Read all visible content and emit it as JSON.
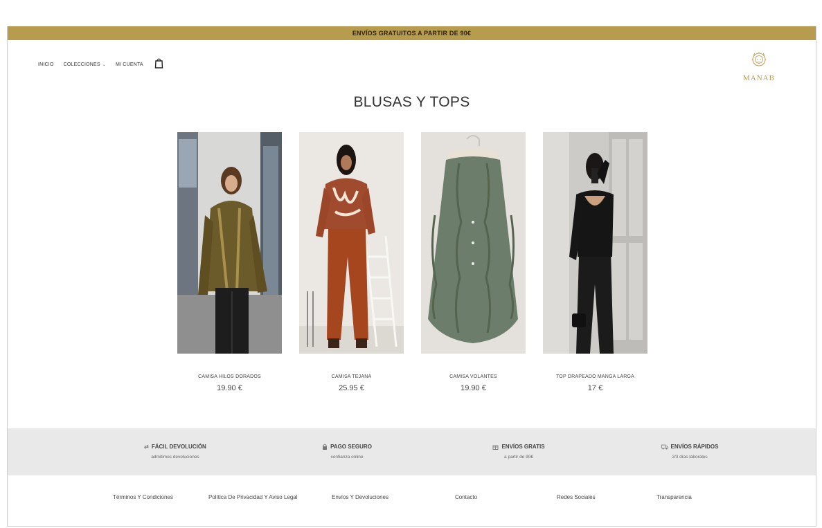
{
  "announcement": "ENVÍOS GRATUITOS A PARTIR DE 90€",
  "nav": {
    "home": "INICIO",
    "collections": "COLECCIONES",
    "collections_caret": "⌄",
    "account": "MI CUENTA"
  },
  "logo": {
    "text": "MANAB",
    "icon": "lion-icon",
    "color": "#b89c4d"
  },
  "page": {
    "title": "BLUSAS Y TOPS"
  },
  "products": [
    {
      "name": "CAMISA HILOS DORADOS",
      "price": "19.90 €"
    },
    {
      "name": "CAMISA TEJANA",
      "price": "25.95 €"
    },
    {
      "name": "CAMISA VOLANTES",
      "price": "19.90 €"
    },
    {
      "name": "TOP DRAPEADO MANGA LARGA",
      "price": "17 €"
    }
  ],
  "features": [
    {
      "title": "FÁCIL DEVOLUCIÓN",
      "sub": "admitimos devoluciones",
      "icon": "return-arrows-icon"
    },
    {
      "title": "PAGO SEGURO",
      "sub": "confianza online",
      "icon": "lock-icon"
    },
    {
      "title": "ENVÍOS GRATIS",
      "sub": "a partir de 90€",
      "icon": "gift-icon"
    },
    {
      "title": "ENVÍOS RÁPIDOS",
      "sub": "2/3 días laborales",
      "icon": "truck-icon"
    }
  ],
  "footer": {
    "links": [
      "Términos Y Condiciones",
      "Política De Privacidad Y Aviso Legal",
      "Envíos Y Devoluciones",
      "Contacto",
      "Redes Sociales",
      "Transparencia"
    ]
  },
  "colors": {
    "accent": "#b89c4d",
    "feature_bg": "#e9e9e9"
  }
}
